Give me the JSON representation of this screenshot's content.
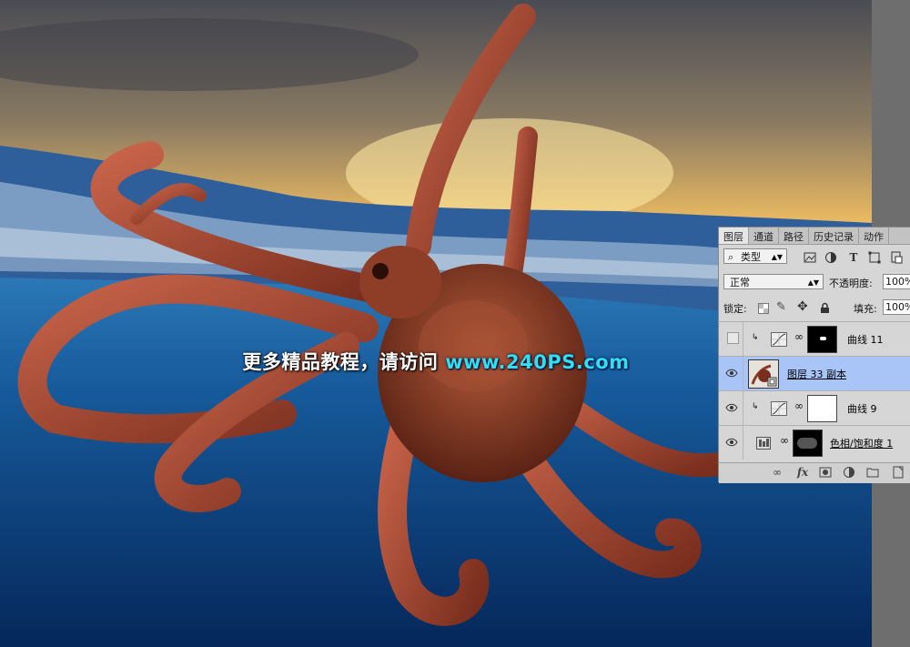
{
  "watermark": {
    "cn_text": "更多精品教程，请访问",
    "url_text": "www.240PS.com"
  },
  "panel": {
    "tabs": [
      "图层",
      "通道",
      "路径",
      "历史记录",
      "动作"
    ],
    "active_tab": "图层",
    "filter": {
      "label": "类型",
      "search_icon": "search-icon"
    },
    "filter_icons": [
      "image-filter-icon",
      "adjustment-filter-icon",
      "type-filter-icon",
      "shape-filter-icon",
      "smart-object-filter-icon"
    ],
    "blend_mode": "正常",
    "opacity_label": "不透明度:",
    "opacity_value": "100%",
    "lock_label": "锁定:",
    "fill_label": "填充:",
    "fill_value": "100%",
    "layers": [
      {
        "name": "曲线 11",
        "visible": false,
        "type": "curves",
        "clipped": true,
        "mask": "black-with-white-spot",
        "selected": false
      },
      {
        "name": "图层 33 副本",
        "visible": true,
        "type": "smart-object",
        "clipped": false,
        "mask": "",
        "selected": true
      },
      {
        "name": "曲线 9",
        "visible": true,
        "type": "curves",
        "clipped": true,
        "mask": "white",
        "selected": false
      },
      {
        "name": "色相/饱和度 1",
        "visible": true,
        "type": "hue-saturation",
        "clipped": false,
        "mask": "black-with-gray",
        "selected": false
      }
    ],
    "bottom_icons": [
      "link-layers-icon",
      "fx-icon",
      "add-mask-icon",
      "new-adjustment-icon",
      "new-group-icon",
      "new-layer-icon"
    ],
    "fx_label": "fx"
  },
  "colors": {
    "selected_row": "#a9c5f7",
    "url_color": "#2ee0f0"
  }
}
